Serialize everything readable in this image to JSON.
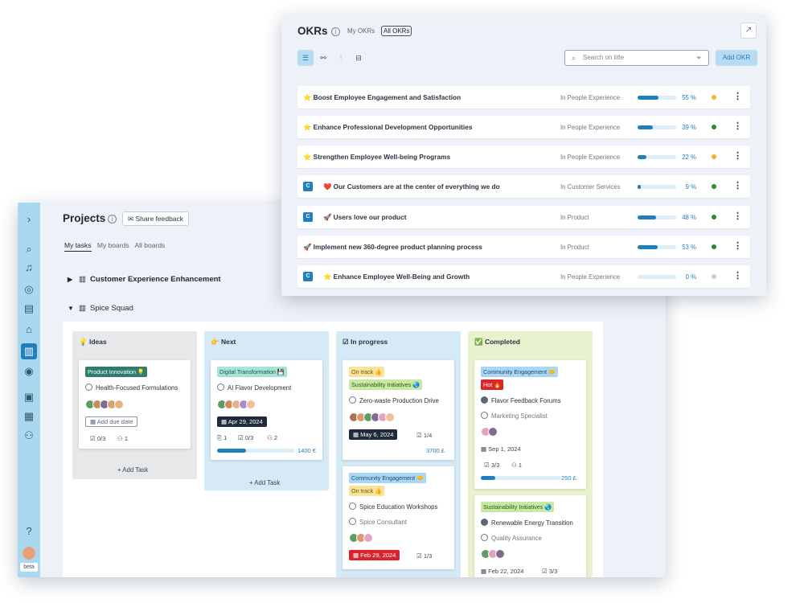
{
  "projects": {
    "title": "Projects",
    "feedback_label": "Share feedback",
    "tabs": [
      "My tasks",
      "My boards",
      "All boards"
    ],
    "groups": [
      {
        "name": "Customer Experience Enhancement",
        "expanded": false
      },
      {
        "name": "Spice Squad",
        "expanded": true
      }
    ],
    "rail_footer": {
      "badge": "beta"
    },
    "columns": [
      {
        "title": "Ideas",
        "emoji": "💡",
        "color": "#e7e8ea",
        "add_label": "Add Task",
        "cards": [
          {
            "tags": [
              {
                "label": "Product Innovation 💡"
              }
            ],
            "title": "Health-Focused Formulations",
            "due": "Add due date",
            "checks": "0/3",
            "people": "1"
          }
        ]
      },
      {
        "title": "Next",
        "emoji": "👉",
        "color": "#d5e9f7",
        "add_label": "Add Task",
        "cards": [
          {
            "tags": [
              {
                "label": "Digital Transformation 💾"
              }
            ],
            "title": "AI Flavor Development",
            "date": "Apr 29, 2024",
            "attachments": "1",
            "checks": "0/3",
            "people": "2",
            "amount": "1400 €",
            "progress": 0.38
          }
        ]
      },
      {
        "title": "In progress",
        "emoji": "☑",
        "color": "#d5e9f7",
        "cards": [
          {
            "tags": [
              {
                "label": "On track 👍"
              },
              {
                "label": "Sustainability Initiatives 🌏"
              }
            ],
            "title": "Zero-waste Production Drive",
            "date": "May 6, 2024",
            "checks": "1/4",
            "amount": "3700 £"
          },
          {
            "tags": [
              {
                "label": "Community Engagement 🤝"
              },
              {
                "label": "On track 👍"
              }
            ],
            "title": "Spice Education Workshops",
            "subtitle": "Spice Consultant",
            "date": "Feb 29, 2024",
            "checks": "1/3"
          }
        ]
      },
      {
        "title": "Completed",
        "emoji": "✅",
        "color": "#e9f2cf",
        "cards": [
          {
            "tags": [
              {
                "label": "Community Engagement 🤝"
              },
              {
                "label": "Hot 🔥"
              }
            ],
            "title": "Flavor Feedback Forums",
            "subtitle": "Marketing Specialist",
            "date": "Sep 1, 2024",
            "checks": "3/3",
            "people": "1",
            "amount": "250 £",
            "progress": 0.18
          },
          {
            "tags": [
              {
                "label": "Sustainability Initiatives 🌏"
              }
            ],
            "title": "Renewable Energy Transition",
            "subtitle": "Quality Assurance",
            "date": "Feb 22, 2024",
            "checks": "3/3"
          }
        ]
      }
    ]
  },
  "okr": {
    "title": "OKRs",
    "tabs": [
      "My OKRs",
      "All OKRs"
    ],
    "active_tab": "All OKRs",
    "search_placeholder": "Search on title",
    "add_label": "Add OKR",
    "rows": [
      {
        "prefix": "⭐",
        "badge": "",
        "name": "Boost Employee Engagement and Satisfaction",
        "team": "In People Experience",
        "progress": 55,
        "pct": "55 %",
        "status": "#f2b231"
      },
      {
        "prefix": "⭐",
        "badge": "",
        "name": "Enhance Professional Development Opportunities",
        "team": "In People Experience",
        "progress": 39,
        "pct": "39 %",
        "status": "#2a8a2a"
      },
      {
        "prefix": "⭐",
        "badge": "",
        "name": "Strengthen Employee Well-being Programs",
        "team": "In People Experience",
        "progress": 22,
        "pct": "22 %",
        "status": "#f2b231"
      },
      {
        "prefix": "❤️",
        "badge": "C",
        "name": "Our Customers are at the center of everything we do",
        "team": "In Customer Services",
        "progress": 9,
        "pct": "9 %",
        "status": "#2a8a2a"
      },
      {
        "prefix": "🚀",
        "badge": "C",
        "name": "Users love our product",
        "team": "In Product",
        "progress": 48,
        "pct": "48 %",
        "status": "#2a8a2a"
      },
      {
        "prefix": "🚀",
        "badge": "",
        "name": "Implement new 360-degree product planning process",
        "team": "In Product",
        "progress": 53,
        "pct": "53 %",
        "status": "#2a8a2a"
      },
      {
        "prefix": "⭐",
        "badge": "C",
        "name": "Enhance Employee Well-Being and Growth",
        "team": "In People Experience",
        "progress": 0,
        "pct": "0 %",
        "status": "#c9ced6"
      }
    ]
  },
  "colors": {
    "accent": "#1f7fbf",
    "rail": "#a9d8ef"
  }
}
